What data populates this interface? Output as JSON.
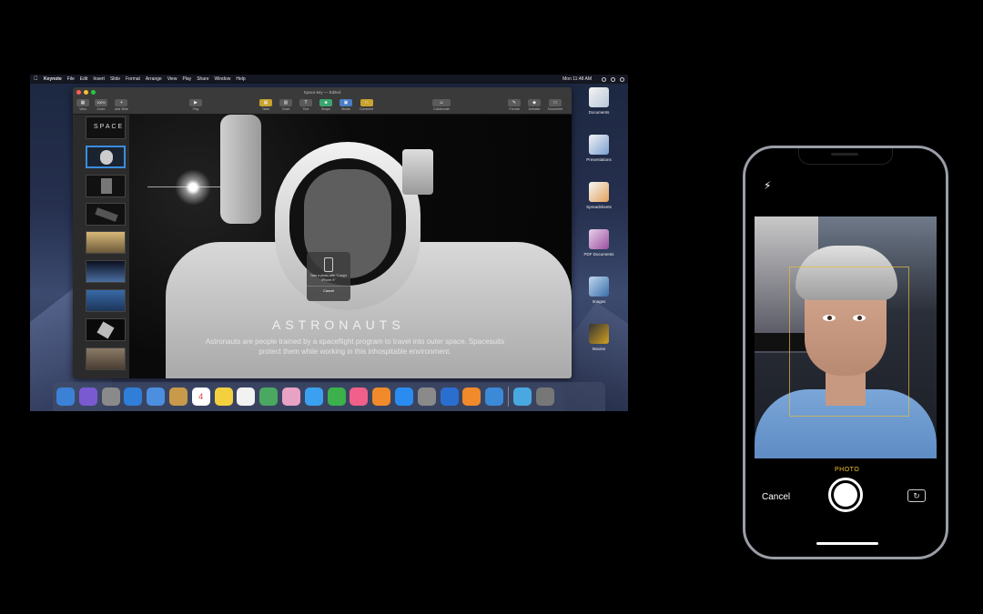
{
  "mac": {
    "menubar": {
      "app_name": "Keynote",
      "items": [
        "File",
        "Edit",
        "Insert",
        "Slide",
        "Format",
        "Arrange",
        "View",
        "Play",
        "Share",
        "Window",
        "Help"
      ],
      "clock": "Mon 11:48 AM"
    },
    "keynote": {
      "window_title": "Space.key — Edited",
      "toolbar": {
        "left": [
          "View",
          "Zoom",
          "Add Slide"
        ],
        "zoom_value": "100%",
        "play": "Play",
        "insert": [
          "Table",
          "Chart",
          "Text",
          "Shape",
          "Media",
          "Comment"
        ],
        "collaborate": "Collaborate",
        "right": [
          "Format",
          "Animate",
          "Document"
        ]
      },
      "navigator_thumb_title": "SPACE",
      "slide": {
        "title": "ASTRONAUTS",
        "body": "Astronauts are people trained by a spaceflight program to travel into outer space. Spacesuits protect them while working in this inhospitable environment."
      },
      "photo_popover": {
        "message": "Take a photo with “Craig's iPhone X”",
        "cancel": "Cancel"
      }
    },
    "desktop_stacks": [
      "Documents",
      "Presentations",
      "Spreadsheets",
      "PDF Documents",
      "Images",
      "Movies"
    ],
    "dock_icons": [
      "finder-icon",
      "siri-icon",
      "launchpad-icon",
      "safari-icon",
      "mail-icon",
      "notes-icon",
      "calendar-icon",
      "stickies-icon",
      "reminders-icon",
      "maps-icon",
      "photos-icon",
      "messages-icon",
      "facetime-icon",
      "itunes-icon",
      "ibooks-icon",
      "appstore-icon",
      "preferences-icon",
      "keynote-icon",
      "pages-icon",
      "xcode-icon",
      "folder-icon",
      "trash-icon"
    ],
    "calendar_day": "4"
  },
  "iphone": {
    "mode_label": "PHOTO",
    "cancel_label": "Cancel"
  },
  "colors": {
    "accent_blue": "#3b8de0",
    "camera_mode_yellow": "#f2c230"
  }
}
